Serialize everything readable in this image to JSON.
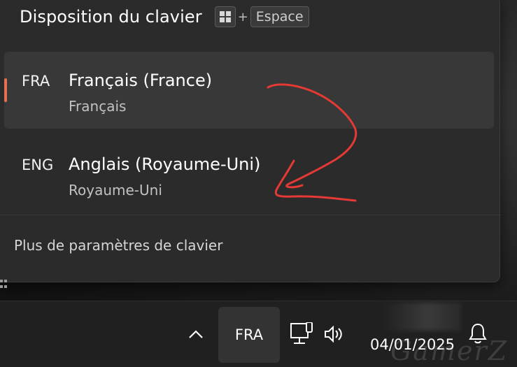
{
  "flyout": {
    "title": "Disposition du clavier",
    "shortcut": {
      "plus": "+",
      "key": "Espace"
    },
    "languages": [
      {
        "code": "FRA",
        "name": "Français (France)",
        "layout": "Français",
        "selected": true
      },
      {
        "code": "ENG",
        "name": "Anglais (Royaume-Uni)",
        "layout": "Royaume-Uni",
        "selected": false
      }
    ],
    "footer_link": "Plus de paramètres de clavier"
  },
  "taskbar": {
    "ime_label": "FRA",
    "date": "04/01/2025"
  },
  "watermark": "GamerZ",
  "colors": {
    "accent": "#e8704e",
    "annotation": "#e53935",
    "flyout_bg": "#2b2b2b",
    "selected_bg": "#383838"
  },
  "icons": {
    "windows_key": "windows-logo-icon",
    "chevron": "chevron-up-icon",
    "network": "network-icon",
    "volume": "volume-icon",
    "notifications": "bell-icon"
  }
}
